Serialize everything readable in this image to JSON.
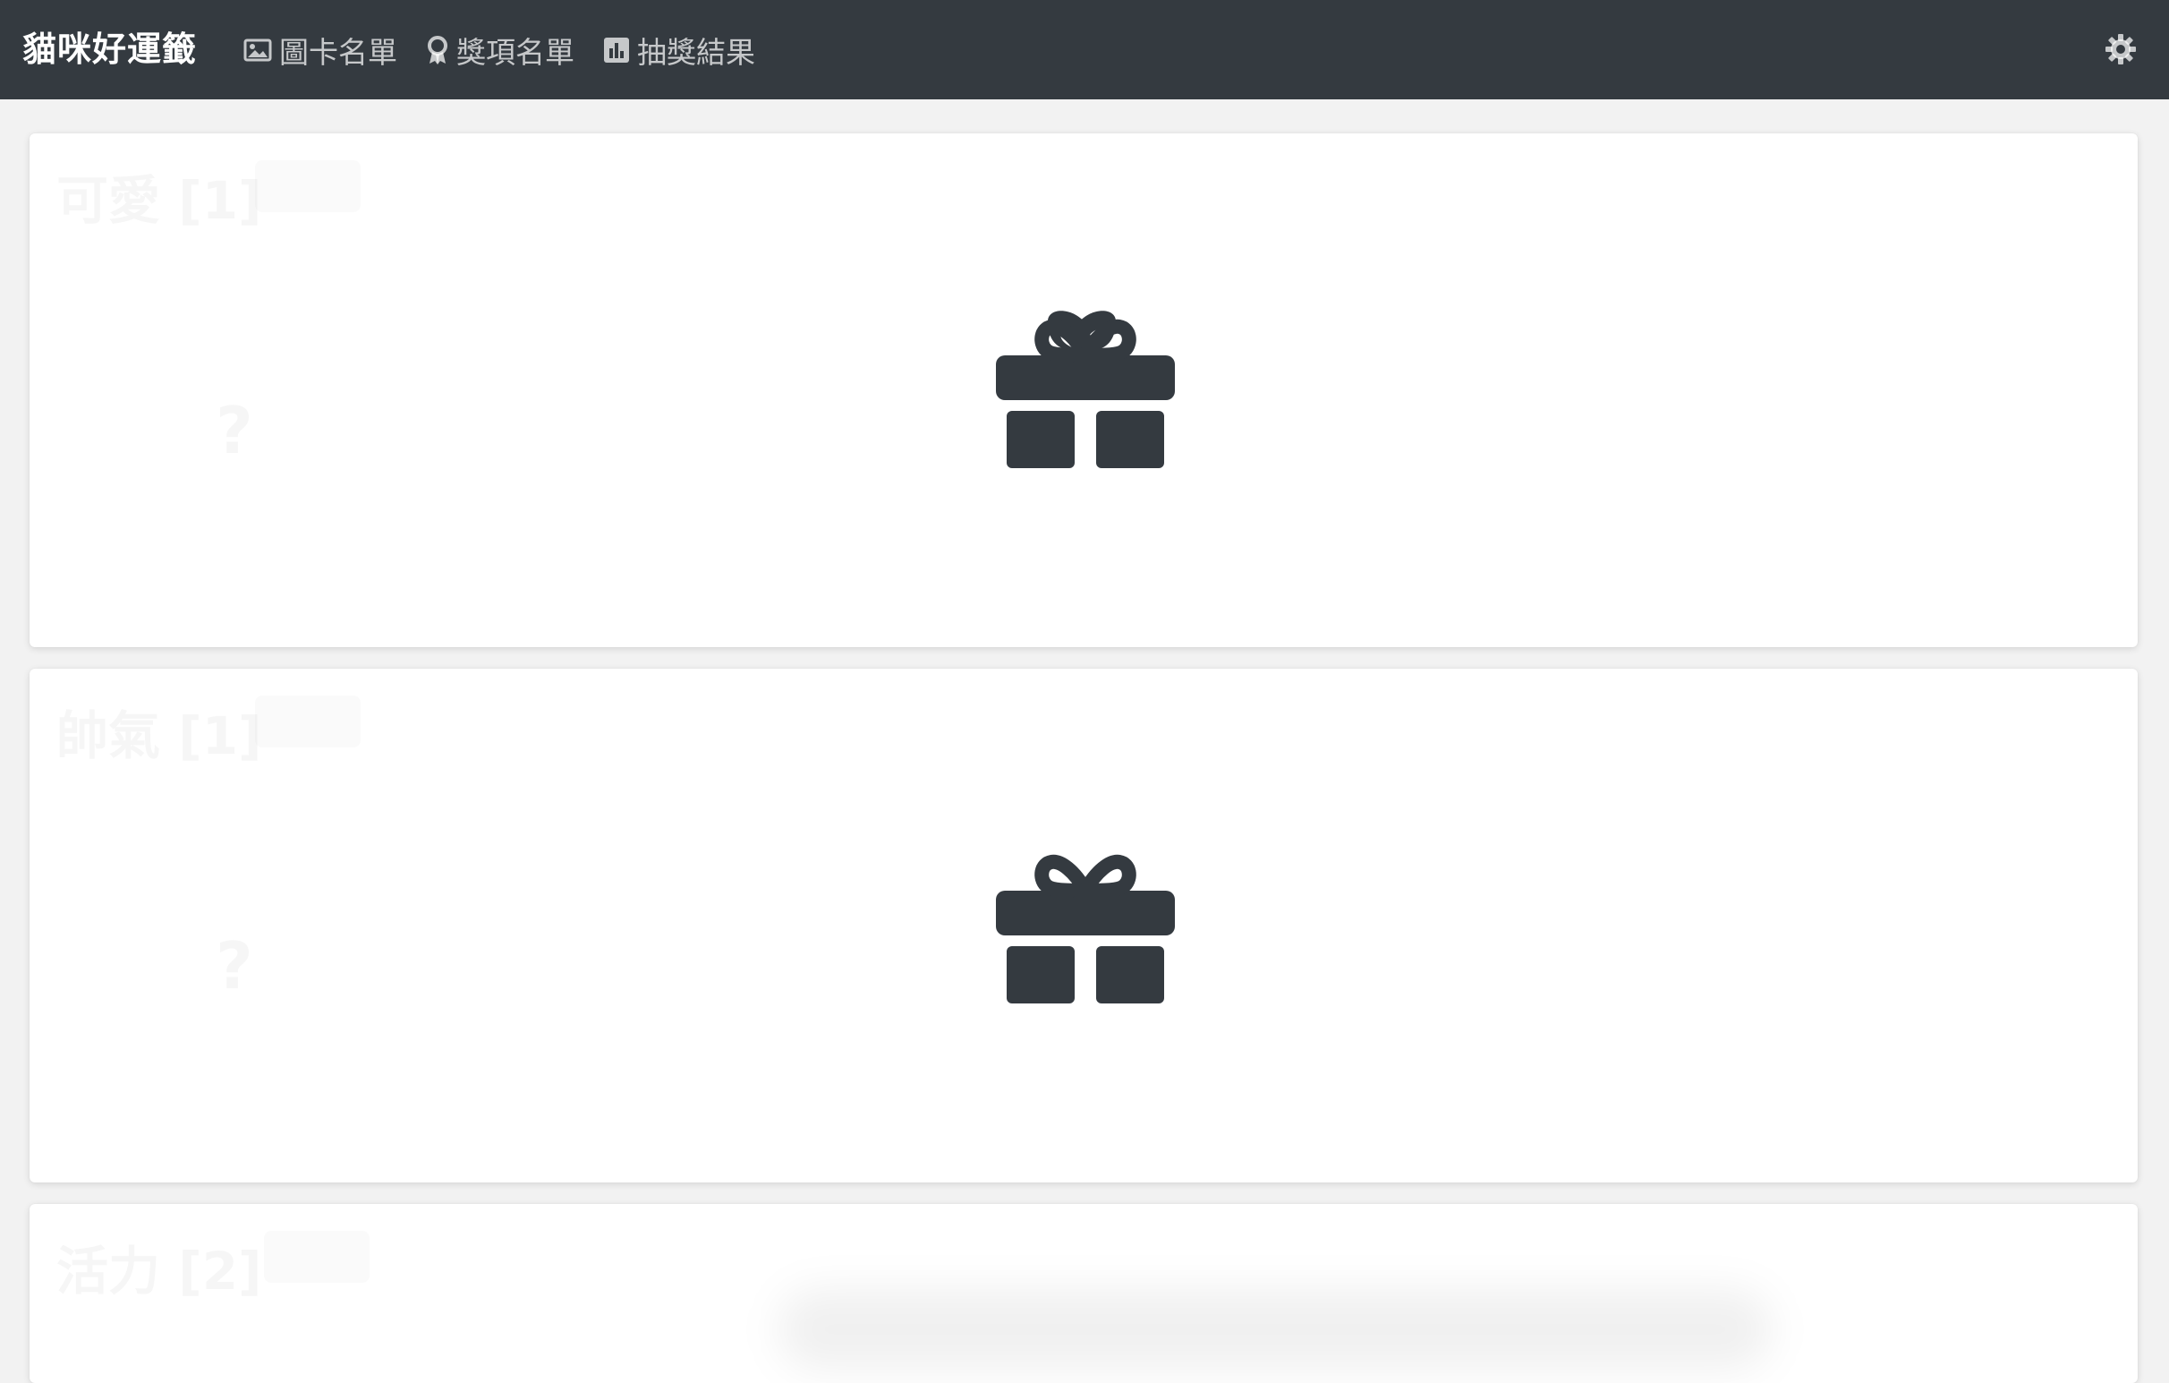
{
  "navbar": {
    "brand": "貓咪好運籤",
    "links": [
      {
        "label": "圖卡名單",
        "icon": "image-icon"
      },
      {
        "label": "獎項名單",
        "icon": "award-icon"
      },
      {
        "label": "抽獎結果",
        "icon": "chart-icon"
      }
    ],
    "settings_icon": "gear-icon"
  },
  "prizes": [
    {
      "title": "可愛 [1]",
      "badge": "",
      "placeholder": "?"
    },
    {
      "title": "帥氣 [1]",
      "badge": "",
      "placeholder": "?"
    },
    {
      "title": "活力 [2]",
      "badge": "",
      "placeholder": ""
    }
  ],
  "colors": {
    "navbar_bg": "#343a40",
    "gift": "#343a40",
    "card_bg": "#ffffff",
    "page_bg": "#f2f2f2"
  }
}
